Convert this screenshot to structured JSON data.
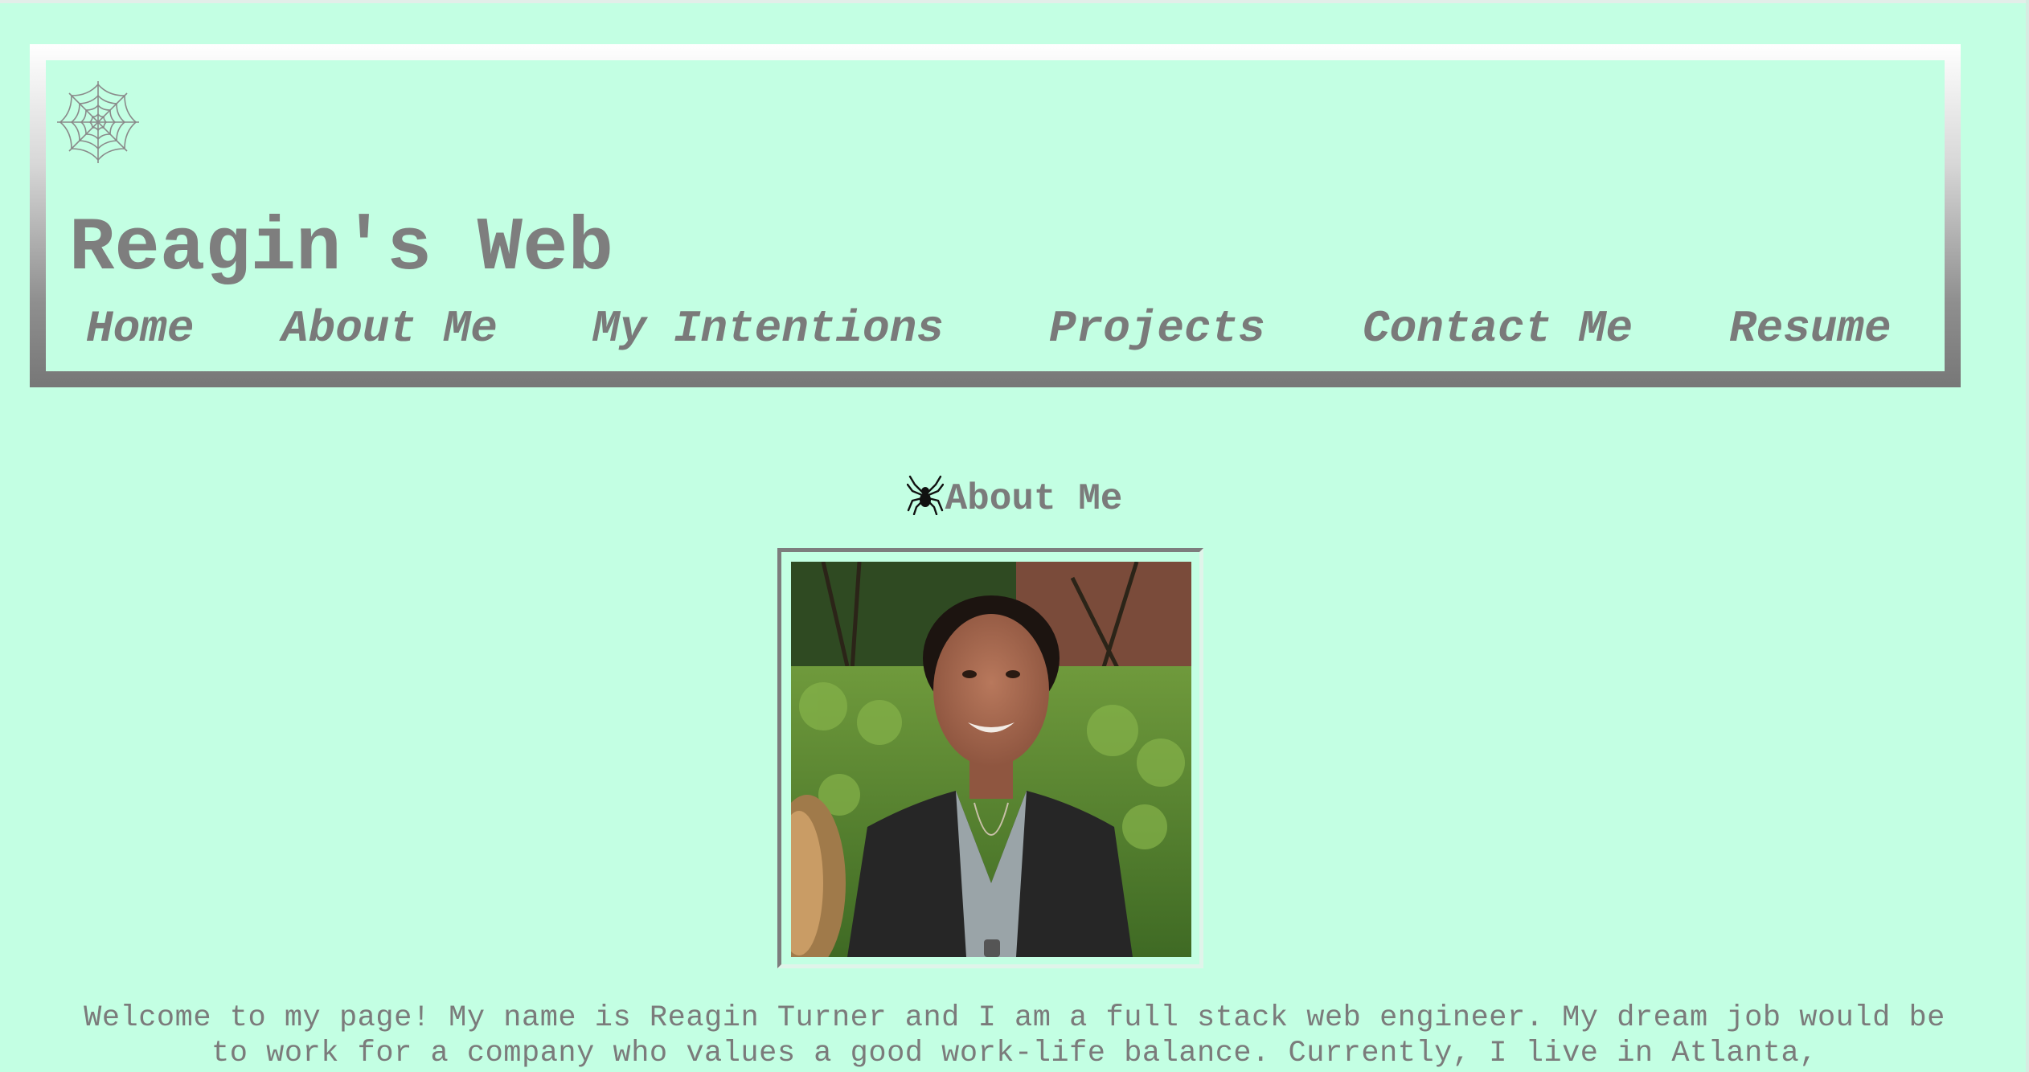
{
  "site": {
    "title": "Reagin's Web",
    "logo_icon": "spider-web-icon"
  },
  "nav": {
    "items": [
      {
        "label": "Home"
      },
      {
        "label": "About Me"
      },
      {
        "label": "My Intentions"
      },
      {
        "label": "Projects"
      },
      {
        "label": "Contact Me"
      },
      {
        "label": "Resume"
      }
    ]
  },
  "about": {
    "heading": "About Me",
    "heading_icon": "spider-icon",
    "photo_subject": "profile-photo",
    "intro": "Welcome to my page! My name is Reagin Turner and I am a full stack web engineer. My dream job would be to work for a company who values a good work-life balance. Currently, I live in Atlanta,"
  },
  "colors": {
    "background": "#c3ffe3",
    "text": "#7b7b7b",
    "border_light": "#ffffff",
    "border_dark": "#777777"
  }
}
